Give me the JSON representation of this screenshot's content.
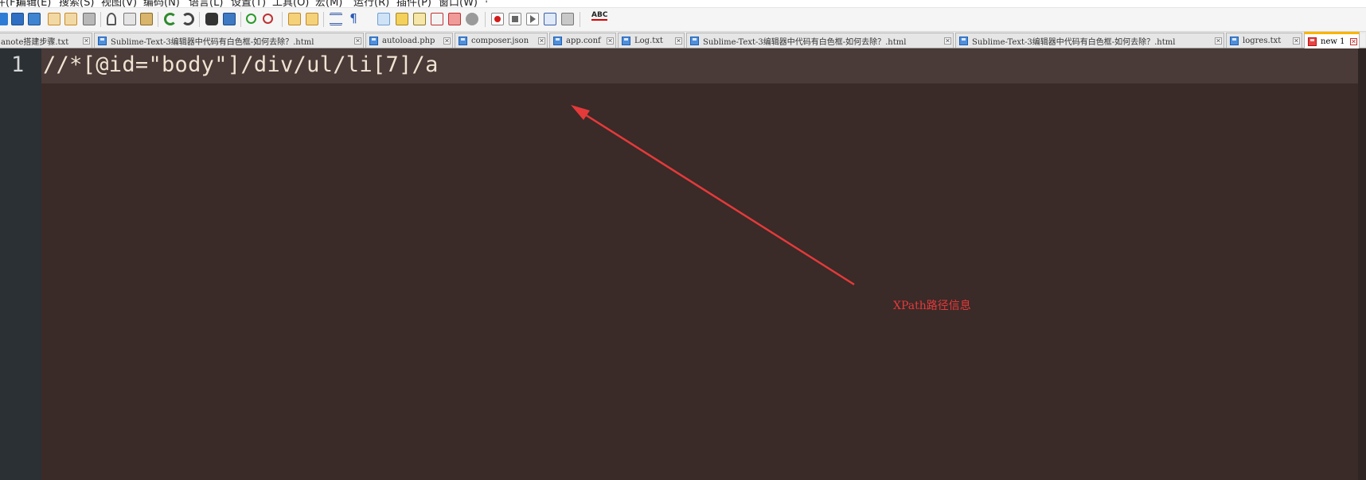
{
  "menu": {
    "items": [
      "件(F)",
      "编辑(E)",
      "搜索(S)",
      "视图(V)",
      "编码(N)",
      "语言(L)",
      "设置(T)",
      "工具(O)",
      "宏(M)",
      "运行(R)",
      "插件(P)",
      "窗口(W)",
      "?"
    ]
  },
  "toolbar": {
    "spellcheck_label": "ABC",
    "buttons": [
      "new-icon",
      "open-icon",
      "save-icon",
      "save-all-icon",
      "close-icon",
      "close-all-icon",
      "print-icon",
      "cut-icon",
      "copy-icon",
      "paste-icon",
      "undo-icon",
      "redo-icon",
      "find-icon",
      "replace-icon",
      "zoom-in-icon",
      "zoom-out-icon",
      "sync-vertical-icon",
      "sync-horizontal-icon",
      "word-wrap-icon",
      "show-all-chars-icon",
      "indent-guide-icon",
      "user-language-icon",
      "document-map-icon",
      "function-list-icon",
      "folder-workspace-icon",
      "monitor-icon",
      "record-macro-icon",
      "stop-record-icon",
      "play-macro-icon",
      "run-macro-multiple-icon",
      "save-macro-icon",
      "spellcheck-icon"
    ],
    "pressed": "indent-guide-icon"
  },
  "tabs": [
    {
      "label": "anote搭建步骤.txt",
      "unsaved": false,
      "active": false
    },
    {
      "label": "Sublime-Text-3编辑器中代码有白色框-如何去除？.html",
      "unsaved": false,
      "active": false
    },
    {
      "label": "autoload.php",
      "unsaved": false,
      "active": false
    },
    {
      "label": "composer.json",
      "unsaved": false,
      "active": false
    },
    {
      "label": "app.conf",
      "unsaved": false,
      "active": false
    },
    {
      "label": "Log.txt",
      "unsaved": false,
      "active": false
    },
    {
      "label": "Sublime-Text-3编辑器中代码有白色框-如何去除？.html",
      "unsaved": false,
      "active": false
    },
    {
      "label": "Sublime-Text-3编辑器中代码有白色框-如何去除？.html",
      "unsaved": false,
      "active": false
    },
    {
      "label": "logres.txt",
      "unsaved": false,
      "active": false
    },
    {
      "label": "new 1",
      "unsaved": true,
      "active": true
    }
  ],
  "editor": {
    "line_number": "1",
    "code": "//*[@id=\"body\"]/div/ul/li[7]/a"
  },
  "annotation": {
    "text": "XPath路径信息",
    "color": "#e43a3a"
  },
  "colors": {
    "editor_background": "#3a2a28",
    "gutter_background": "#2a3034",
    "current_line": "#4a3a38",
    "code_text": "#efe4d2",
    "active_tab_accent": "#fab400"
  }
}
